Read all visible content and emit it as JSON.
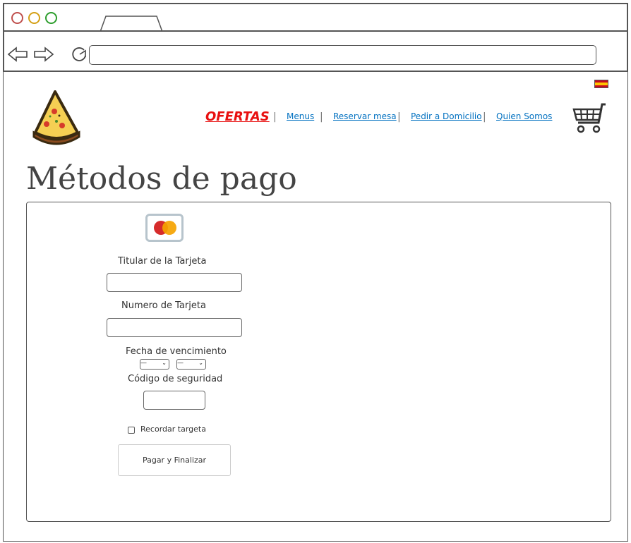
{
  "browser": {
    "tab_label": "",
    "url": ""
  },
  "header": {
    "flag": "spain-flag",
    "nav": {
      "ofertas": "OFERTAS",
      "menus": "Menus",
      "reservar": "Reservar mesa",
      "pedir": "Pedir a Domicilio",
      "quien": "Quien Somos"
    },
    "separator": "|"
  },
  "page": {
    "title": "Métodos de pago"
  },
  "form": {
    "card_type": "mastercard",
    "titular_label": "Titular de la Tarjeta",
    "titular_value": "",
    "numero_label": "Numero de Tarjeta",
    "numero_value": "",
    "fecha_label": "Fecha de vencimiento",
    "month_value": "—",
    "year_value": "—",
    "codigo_label": "Código de seguridad",
    "codigo_value": "",
    "remember_label": "Recordar targeta",
    "remember_checked": false,
    "submit_label": "Pagar y Finalizar"
  },
  "colors": {
    "ofertas": "#e81010",
    "nav_link": "#0070c0",
    "mc_red": "#d62b2b",
    "mc_orange": "#f5a300"
  }
}
